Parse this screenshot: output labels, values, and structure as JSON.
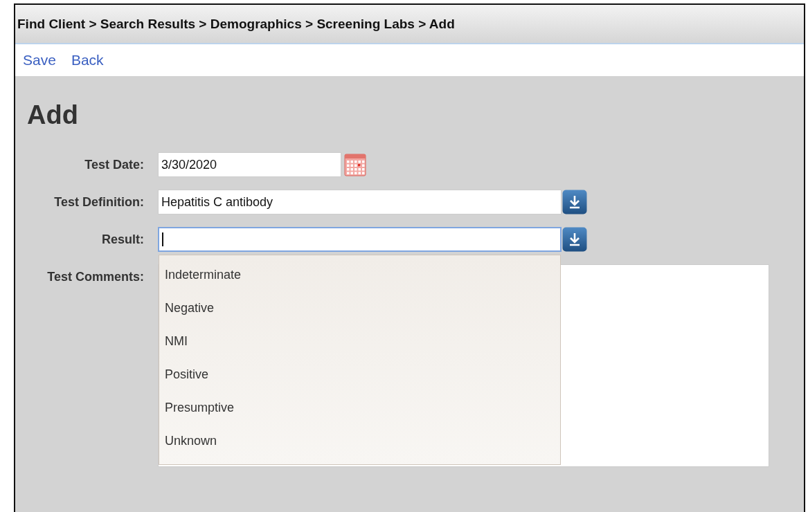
{
  "breadcrumb": "Find Client > Search Results > Demographics > Screening Labs > Add",
  "actions": [
    "Save",
    "Back"
  ],
  "heading": "Add",
  "fields": [
    {
      "kind": "date",
      "label": "Test Date:",
      "value": "3/30/2020",
      "focused": false
    },
    {
      "kind": "select",
      "label": "Test Definition:",
      "value": "Hepatitis C antibody",
      "focused": false
    },
    {
      "kind": "select",
      "label": "Result:",
      "focused": true,
      "expanded": true,
      "options": [
        "Indeterminate",
        "Negative",
        "NMI",
        "Positive",
        "Presumptive",
        "Unknown"
      ]
    },
    {
      "kind": "textarea",
      "label": "Test Comments:",
      "focused": false
    }
  ]
}
